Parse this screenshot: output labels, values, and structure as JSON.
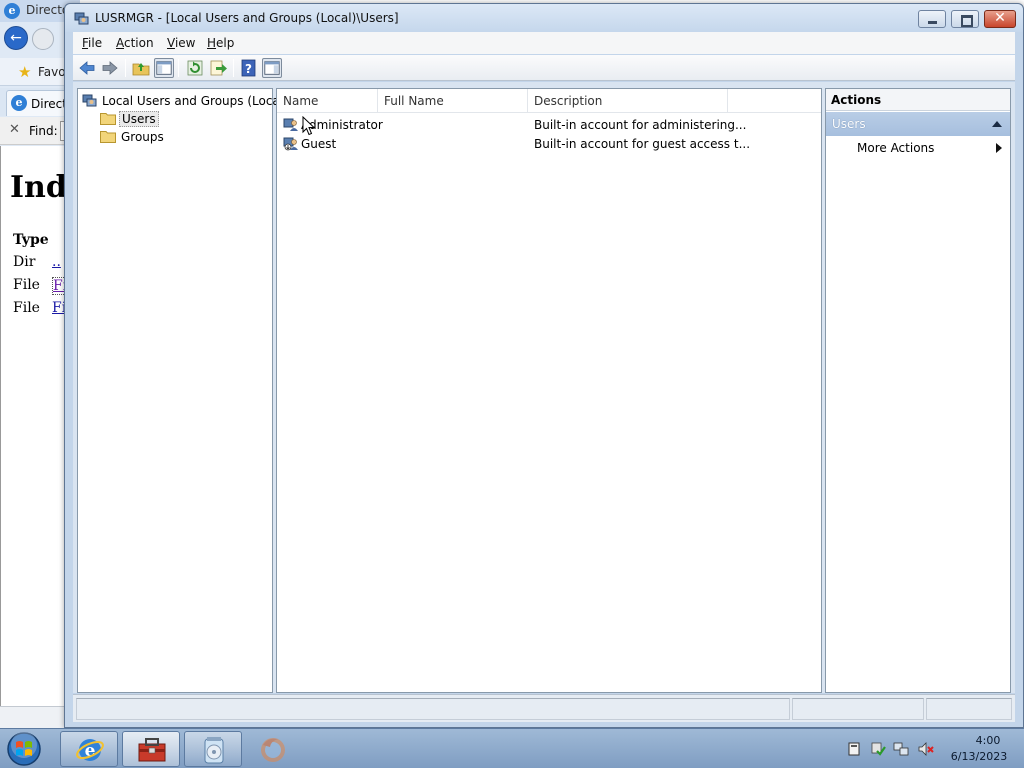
{
  "background_window": {
    "title": "Directo",
    "favorites_label": "Favo",
    "tab_label": "Directo",
    "find_label": "Find:",
    "page_heading": "Inde",
    "type_header": "Type",
    "rows": [
      {
        "type": "Dir",
        "link": ".."
      },
      {
        "type": "File",
        "link": "Fi"
      },
      {
        "type": "File",
        "link": "Fi"
      }
    ]
  },
  "window": {
    "title": "LUSRMGR - [Local Users and Groups (Local)\\Users]"
  },
  "menu": {
    "items": [
      {
        "accel": "F",
        "rest": "ile"
      },
      {
        "accel": "A",
        "rest": "ction"
      },
      {
        "accel": "V",
        "rest": "iew"
      },
      {
        "accel": "H",
        "rest": "elp"
      }
    ]
  },
  "tree": {
    "root": "Local Users and Groups (Local)",
    "children": [
      "Users",
      "Groups"
    ],
    "selected": "Users"
  },
  "list": {
    "columns": [
      "Name",
      "Full Name",
      "Description"
    ],
    "rows": [
      {
        "name": "Administrator",
        "full_name": "",
        "description": "Built-in account for administering..."
      },
      {
        "name": "Guest",
        "full_name": "",
        "description": "Built-in account for guest access t..."
      }
    ]
  },
  "actions": {
    "title": "Actions",
    "group": "Users",
    "more_actions": "More Actions"
  },
  "taskbar": {
    "time": "4:00",
    "date": "6/13/2023"
  },
  "colors": {
    "actions_group_bg": "#a6bfde",
    "titlebar": "#c5d7ec",
    "close_button": "#c8452c"
  }
}
